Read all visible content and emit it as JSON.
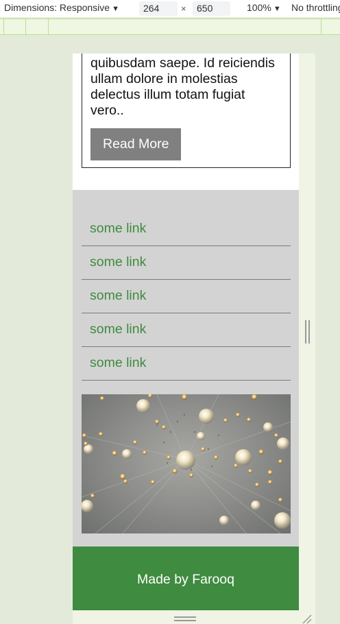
{
  "devtools": {
    "dimensions_label": "Dimensions: Responsive",
    "width": "264",
    "height": "650",
    "separator": "×",
    "zoom": "100%",
    "throttling": "No throttling"
  },
  "page": {
    "card_text": "quibusdam saepe. Id reiciendis ullam dolore in molestias delectus illum totam fugiat vero..",
    "read_more_label": "Read More",
    "links": [
      {
        "label": "some link"
      },
      {
        "label": "some link"
      },
      {
        "label": "some link"
      },
      {
        "label": "some link"
      },
      {
        "label": "some link"
      }
    ],
    "footer_text": "Made by Farooq"
  },
  "colors": {
    "accent_green": "#3f8b3f",
    "button_gray": "#808080",
    "section_gray": "#d3d3d3"
  }
}
